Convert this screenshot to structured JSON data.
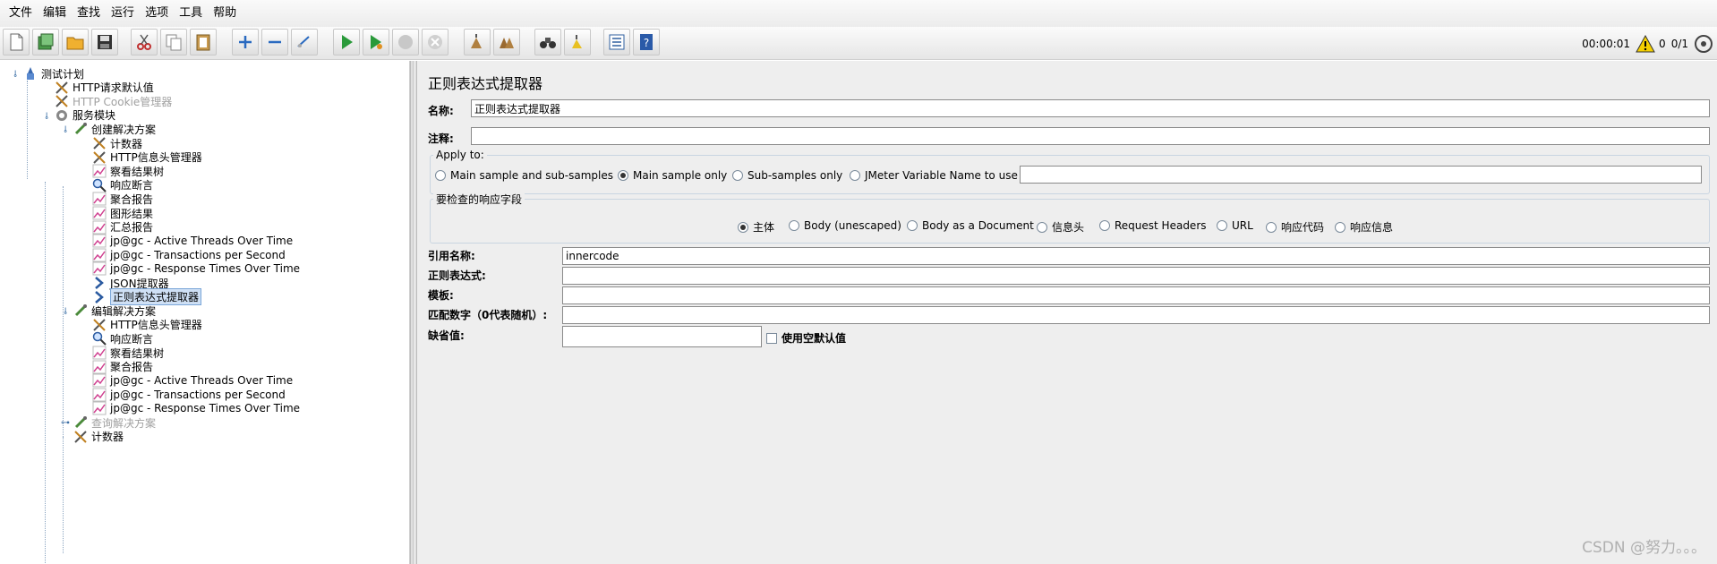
{
  "menu": [
    "文件",
    "编辑",
    "查找",
    "运行",
    "选项",
    "工具",
    "帮助"
  ],
  "status": {
    "time": "00:00:01",
    "warnings": "0",
    "threads": "0/1"
  },
  "tree": [
    {
      "label": "测试计划",
      "icon": "test-plan-icon",
      "level": 0,
      "disabled": false,
      "selected": false,
      "toggle": "open"
    },
    {
      "label": "HTTP请求默认值",
      "icon": "wrench-icon",
      "level": 1,
      "disabled": false,
      "selected": false
    },
    {
      "label": "HTTP Cookie管理器",
      "icon": "wrench-icon",
      "level": 1,
      "disabled": true,
      "selected": false
    },
    {
      "label": "服务模块",
      "icon": "gear-icon",
      "level": 1,
      "disabled": false,
      "selected": false,
      "toggle": "open"
    },
    {
      "label": "创建解决方案",
      "icon": "pipette-icon",
      "level": 2,
      "disabled": false,
      "selected": false,
      "toggle": "open"
    },
    {
      "label": "计数器",
      "icon": "wrench-icon",
      "level": 3,
      "disabled": false,
      "selected": false
    },
    {
      "label": "HTTP信息头管理器",
      "icon": "wrench-icon",
      "level": 3,
      "disabled": false,
      "selected": false
    },
    {
      "label": "察看结果树",
      "icon": "graph-icon",
      "level": 3,
      "disabled": false,
      "selected": false
    },
    {
      "label": "响应断言",
      "icon": "magnifier-icon",
      "level": 3,
      "disabled": false,
      "selected": false
    },
    {
      "label": "聚合报告",
      "icon": "graph-icon",
      "level": 3,
      "disabled": false,
      "selected": false
    },
    {
      "label": "图形结果",
      "icon": "graph-icon",
      "level": 3,
      "disabled": false,
      "selected": false
    },
    {
      "label": "汇总报告",
      "icon": "graph-icon",
      "level": 3,
      "disabled": false,
      "selected": false
    },
    {
      "label": "jp@gc - Active Threads Over Time",
      "icon": "graph-icon",
      "level": 3,
      "disabled": false,
      "selected": false
    },
    {
      "label": "jp@gc - Transactions per Second",
      "icon": "graph-icon",
      "level": 3,
      "disabled": false,
      "selected": false
    },
    {
      "label": "jp@gc - Response Times Over Time",
      "icon": "graph-icon",
      "level": 3,
      "disabled": false,
      "selected": false
    },
    {
      "label": "JSON提取器",
      "icon": "extractor-icon",
      "level": 3,
      "disabled": false,
      "selected": false
    },
    {
      "label": "正则表达式提取器",
      "icon": "extractor-icon",
      "level": 3,
      "disabled": false,
      "selected": true
    },
    {
      "label": "编辑解决方案",
      "icon": "pipette-icon",
      "level": 2,
      "disabled": false,
      "selected": false,
      "toggle": "open"
    },
    {
      "label": "HTTP信息头管理器",
      "icon": "wrench-icon",
      "level": 3,
      "disabled": false,
      "selected": false
    },
    {
      "label": "响应断言",
      "icon": "magnifier-icon",
      "level": 3,
      "disabled": false,
      "selected": false
    },
    {
      "label": "察看结果树",
      "icon": "graph-icon",
      "level": 3,
      "disabled": false,
      "selected": false
    },
    {
      "label": "聚合报告",
      "icon": "graph-icon",
      "level": 3,
      "disabled": false,
      "selected": false
    },
    {
      "label": "jp@gc - Active Threads Over Time",
      "icon": "graph-icon",
      "level": 3,
      "disabled": false,
      "selected": false
    },
    {
      "label": "jp@gc - Transactions per Second",
      "icon": "graph-icon",
      "level": 3,
      "disabled": false,
      "selected": false
    },
    {
      "label": "jp@gc - Response Times Over Time",
      "icon": "graph-icon",
      "level": 3,
      "disabled": false,
      "selected": false
    },
    {
      "label": "查询解决方案",
      "icon": "pipette-icon",
      "level": 2,
      "disabled": true,
      "selected": false,
      "toggle": "closed"
    },
    {
      "label": "计数器",
      "icon": "wrench-icon",
      "level": 2,
      "disabled": false,
      "selected": false
    }
  ],
  "editor": {
    "title": "正则表达式提取器",
    "name_label": "名称:",
    "name_value": "正则表达式提取器",
    "comment_label": "注释:",
    "comment_value": "",
    "apply_to": {
      "title": "Apply to:",
      "options": [
        "Main sample and sub-samples",
        "Main sample only",
        "Sub-samples only",
        "JMeter Variable Name to use"
      ],
      "selected": "Main sample only",
      "variable_value": ""
    },
    "field_to_check": {
      "title": "要检查的响应字段",
      "options": [
        "主体",
        "Body (unescaped)",
        "Body as a Document",
        "信息头",
        "Request Headers",
        "URL",
        "响应代码",
        "响应信息"
      ],
      "selected": "主体"
    },
    "ref_name_label": "引用名称:",
    "ref_name_value": "innercode",
    "regex_label": "正则表达式:",
    "regex_value": "",
    "template_label": "模板:",
    "template_value": "",
    "match_no_label": "匹配数字（0代表随机）:",
    "match_no_value": "",
    "default_label": "缺省值:",
    "default_value": "",
    "use_empty_default_label": "使用空默认值"
  },
  "watermark": "CSDN @努力。。。"
}
